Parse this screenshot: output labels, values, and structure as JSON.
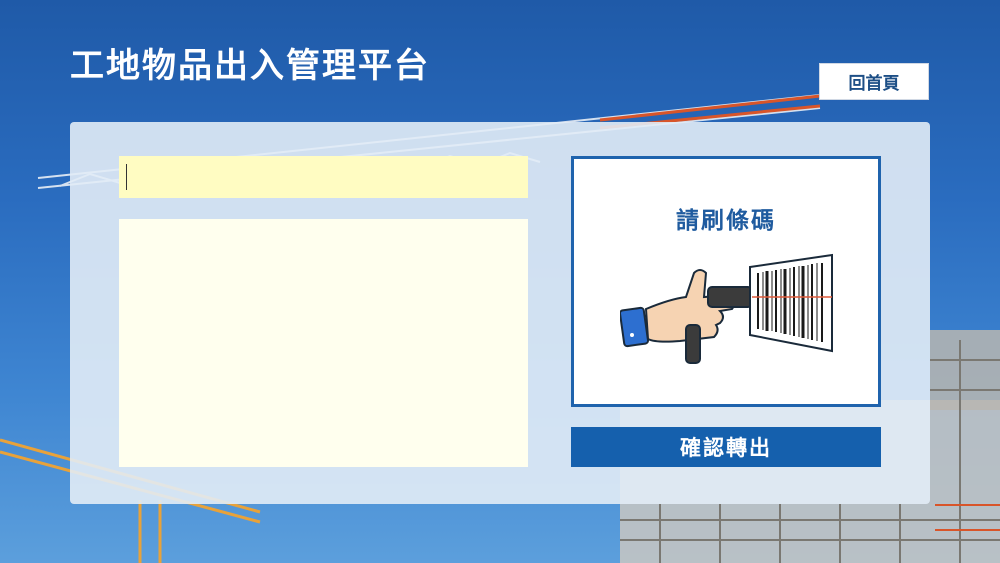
{
  "header": {
    "title": "工地物品出入管理平台"
  },
  "nav": {
    "home_label": "回首頁"
  },
  "scan": {
    "input_value": "",
    "prompt_label": "請刷條碼"
  },
  "actions": {
    "confirm_label": "確認轉出"
  }
}
